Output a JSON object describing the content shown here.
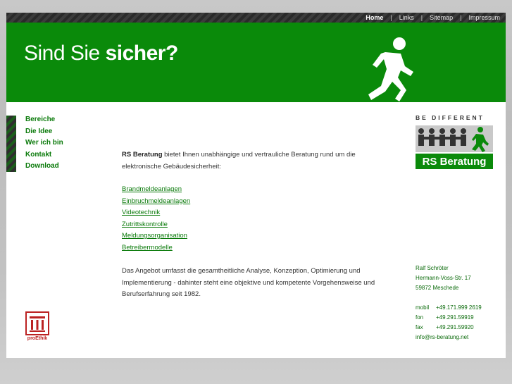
{
  "topnav": {
    "items": [
      {
        "label": "Home",
        "active": true
      },
      {
        "label": "Links"
      },
      {
        "label": "Sitemap"
      },
      {
        "label": "Impressum"
      }
    ],
    "separator": "|"
  },
  "header": {
    "slogan_normal": "Sind Sie ",
    "slogan_bold": "sicher?",
    "background": "#0a8a0a"
  },
  "leftnav": {
    "items": [
      "Bereiche",
      "Die Idee",
      "Wer ich bin",
      "Kontakt",
      "Download"
    ]
  },
  "main": {
    "intro_bold": "RS Beratung",
    "intro_text": " bietet Ihnen unabhängige und vertrauliche Beratung rund um die elektronische Gebäudesicherheit:",
    "links": [
      "Brandmeldeanlagen",
      "Einbruchmeldeanlagen",
      "Videotechnik",
      "Zutrittskontrolle",
      "Meldungsorganisation",
      "Betreibermodelle"
    ],
    "outro": "Das Angebot umfasst die gesamtheitliche Analyse, Konzeption, Optimierung und Implementierung - dahinter steht eine objektive und kompetente Vorgehensweise und Berufserfahrung seit 1982."
  },
  "logo": {
    "tagline": "BE DIFFERENT",
    "name": "RS Beratung"
  },
  "contact": {
    "name": "Ralf Schröter",
    "street": "Hermann-Voss-Str. 17",
    "city": "59872 Meschede",
    "mobil_label": "mobil",
    "mobil": "+49.171.999 2619",
    "fon_label": "fon",
    "fon": "+49.291.59919",
    "fax_label": "fax",
    "fax": "+49.291.59920",
    "email": "info@rs-beratung.net"
  },
  "proethik": {
    "label": "proEthik"
  },
  "colors": {
    "accent": "#0a8a0a",
    "link": "#0a7a0a",
    "topbar": "#2a2a2a"
  }
}
